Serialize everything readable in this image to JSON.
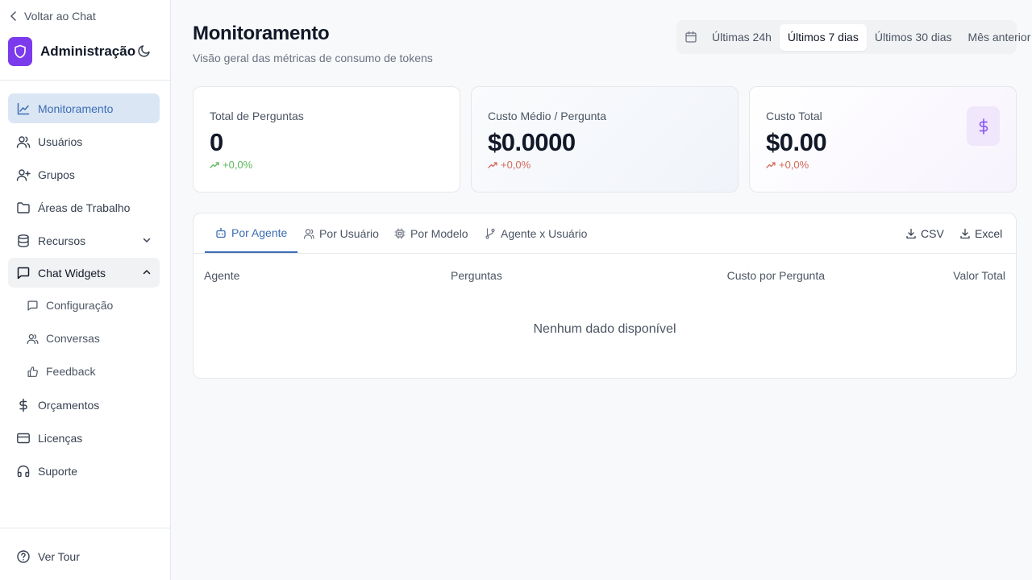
{
  "sidebar": {
    "back_label": "Voltar ao Chat",
    "title": "Administração",
    "nav": [
      {
        "label": "Monitoramento",
        "icon": "line-chart-icon"
      },
      {
        "label": "Usuários",
        "icon": "users-icon"
      },
      {
        "label": "Grupos",
        "icon": "user-plus-icon"
      },
      {
        "label": "Áreas de Trabalho",
        "icon": "folder-icon"
      },
      {
        "label": "Recursos",
        "icon": "database-icon"
      },
      {
        "label": "Chat Widgets",
        "icon": "message-square-icon"
      }
    ],
    "sub_nav": [
      {
        "label": "Configuração",
        "icon": "message-square-icon"
      },
      {
        "label": "Conversas",
        "icon": "users-icon"
      },
      {
        "label": "Feedback",
        "icon": "thumbs-up-icon"
      }
    ],
    "nav_bottom": [
      {
        "label": "Orçamentos",
        "icon": "dollar-icon"
      },
      {
        "label": "Licenças",
        "icon": "credit-card-icon"
      },
      {
        "label": "Suporte",
        "icon": "headphones-icon"
      }
    ],
    "tour_label": "Ver Tour"
  },
  "header": {
    "title": "Monitoramento",
    "subtitle": "Visão geral das métricas de consumo de tokens"
  },
  "range": {
    "options": [
      "Últimas 24h",
      "Últimos 7 dias",
      "Últimos 30 dias",
      "Mês anterior"
    ],
    "selected": "Últimos 7 dias"
  },
  "cards": [
    {
      "label": "Total de Perguntas",
      "value": "0",
      "trend": "+0,0%",
      "trend_color": "#5cb85c"
    },
    {
      "label": "Custo Médio / Pergunta",
      "value": "$0.0000",
      "trend": "+0,0%",
      "trend_color": "#d46a5a"
    },
    {
      "label": "Custo Total",
      "value": "$0.00",
      "trend": "+0,0%",
      "trend_color": "#d46a5a"
    }
  ],
  "tabs": [
    "Por Agente",
    "Por Usuário",
    "Por Modelo",
    "Agente x Usuário"
  ],
  "exports": [
    "CSV",
    "Excel"
  ],
  "table": {
    "columns": [
      "Agente",
      "Perguntas",
      "Custo por Pergunta",
      "Valor Total"
    ],
    "empty_text": "Nenhum dado disponível"
  },
  "colors": {
    "accent": "#3b6db3",
    "brand": "#7c3aed",
    "active_bg": "#dbe6f5"
  }
}
